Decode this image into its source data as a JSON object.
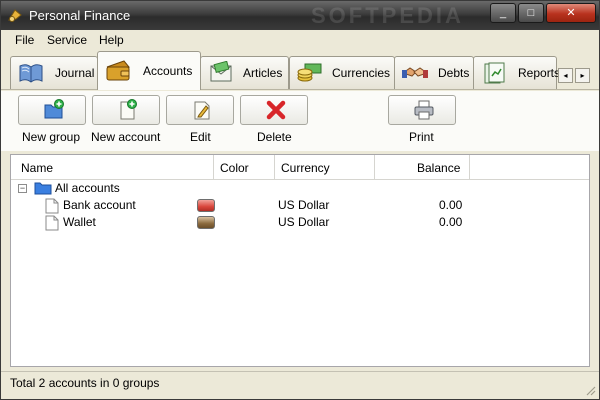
{
  "window": {
    "title": "Personal Finance",
    "watermark": "SOFTPEDIA",
    "minimize_glyph": "_",
    "maximize_glyph": "□",
    "close_glyph": "✕"
  },
  "menu": [
    "File",
    "Service",
    "Help"
  ],
  "tabs": [
    {
      "label": "Journal",
      "icon": "book-icon",
      "active": false
    },
    {
      "label": "Accounts",
      "icon": "wallet-icon",
      "active": true
    },
    {
      "label": "Articles",
      "icon": "money-envelope-icon",
      "active": false
    },
    {
      "label": "Currencies",
      "icon": "coins-icon",
      "active": false
    },
    {
      "label": "Debts",
      "icon": "handshake-icon",
      "active": false
    },
    {
      "label": "Reports",
      "icon": "report-icon",
      "active": false
    }
  ],
  "tab_scroll": {
    "left": "◂",
    "right": "▸"
  },
  "toolbar": {
    "new_group": "New group",
    "new_account": "New account",
    "edit": "Edit",
    "delete": "Delete",
    "print": "Print"
  },
  "table": {
    "headers": {
      "name": "Name",
      "color": "Color",
      "currency": "Currency",
      "balance": "Balance"
    },
    "tree_toggle": "−",
    "group": {
      "name": "All accounts"
    },
    "rows": [
      {
        "name": "Bank account",
        "color": "#d9463c",
        "currency": "US Dollar",
        "balance": "0.00"
      },
      {
        "name": "Wallet",
        "color": "#8a6a3e",
        "currency": "US Dollar",
        "balance": "0.00"
      }
    ]
  },
  "status": "Total 2 accounts in 0 groups"
}
